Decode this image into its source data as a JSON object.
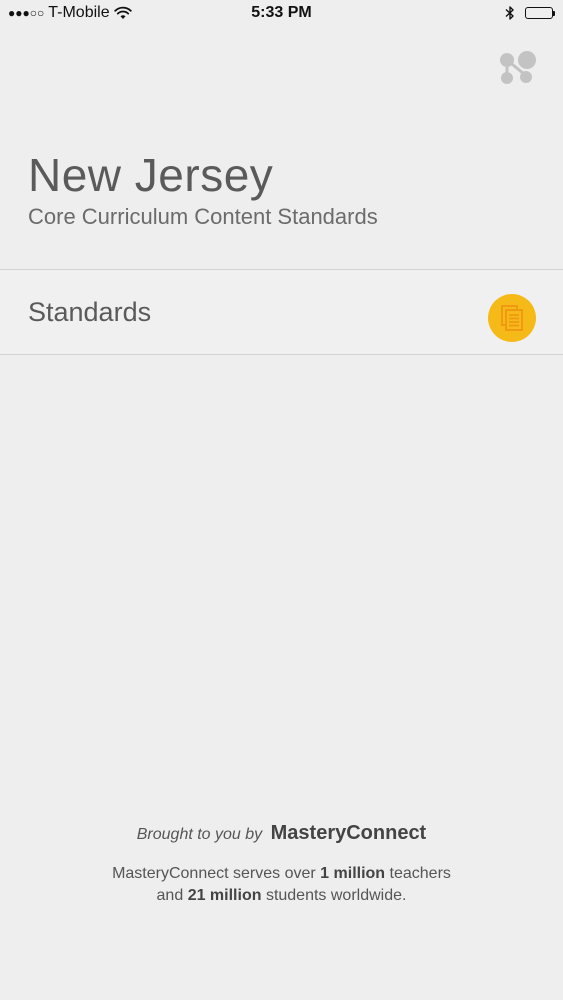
{
  "status_bar": {
    "signal": "●●●○○",
    "carrier": "T-Mobile",
    "time": "5:33 PM"
  },
  "header": {
    "title": "New Jersey",
    "subtitle": "Core Curriculum Content Standards"
  },
  "list": {
    "items": [
      {
        "label": "Standards",
        "icon": "documents-icon",
        "icon_color": "#f5b918"
      }
    ]
  },
  "footer": {
    "brought_prefix": "Brought to you by",
    "brand": "MasteryConnect",
    "line1_a": "MasteryConnect serves over",
    "line1_b": "1 million",
    "line1_c": "teachers",
    "line2_a": "and",
    "line2_b": "21 million",
    "line2_c": "students worldwide."
  },
  "icons": {
    "share": "share-icon",
    "wifi": "wifi-icon",
    "bluetooth": "bluetooth-icon",
    "battery": "battery-icon"
  }
}
